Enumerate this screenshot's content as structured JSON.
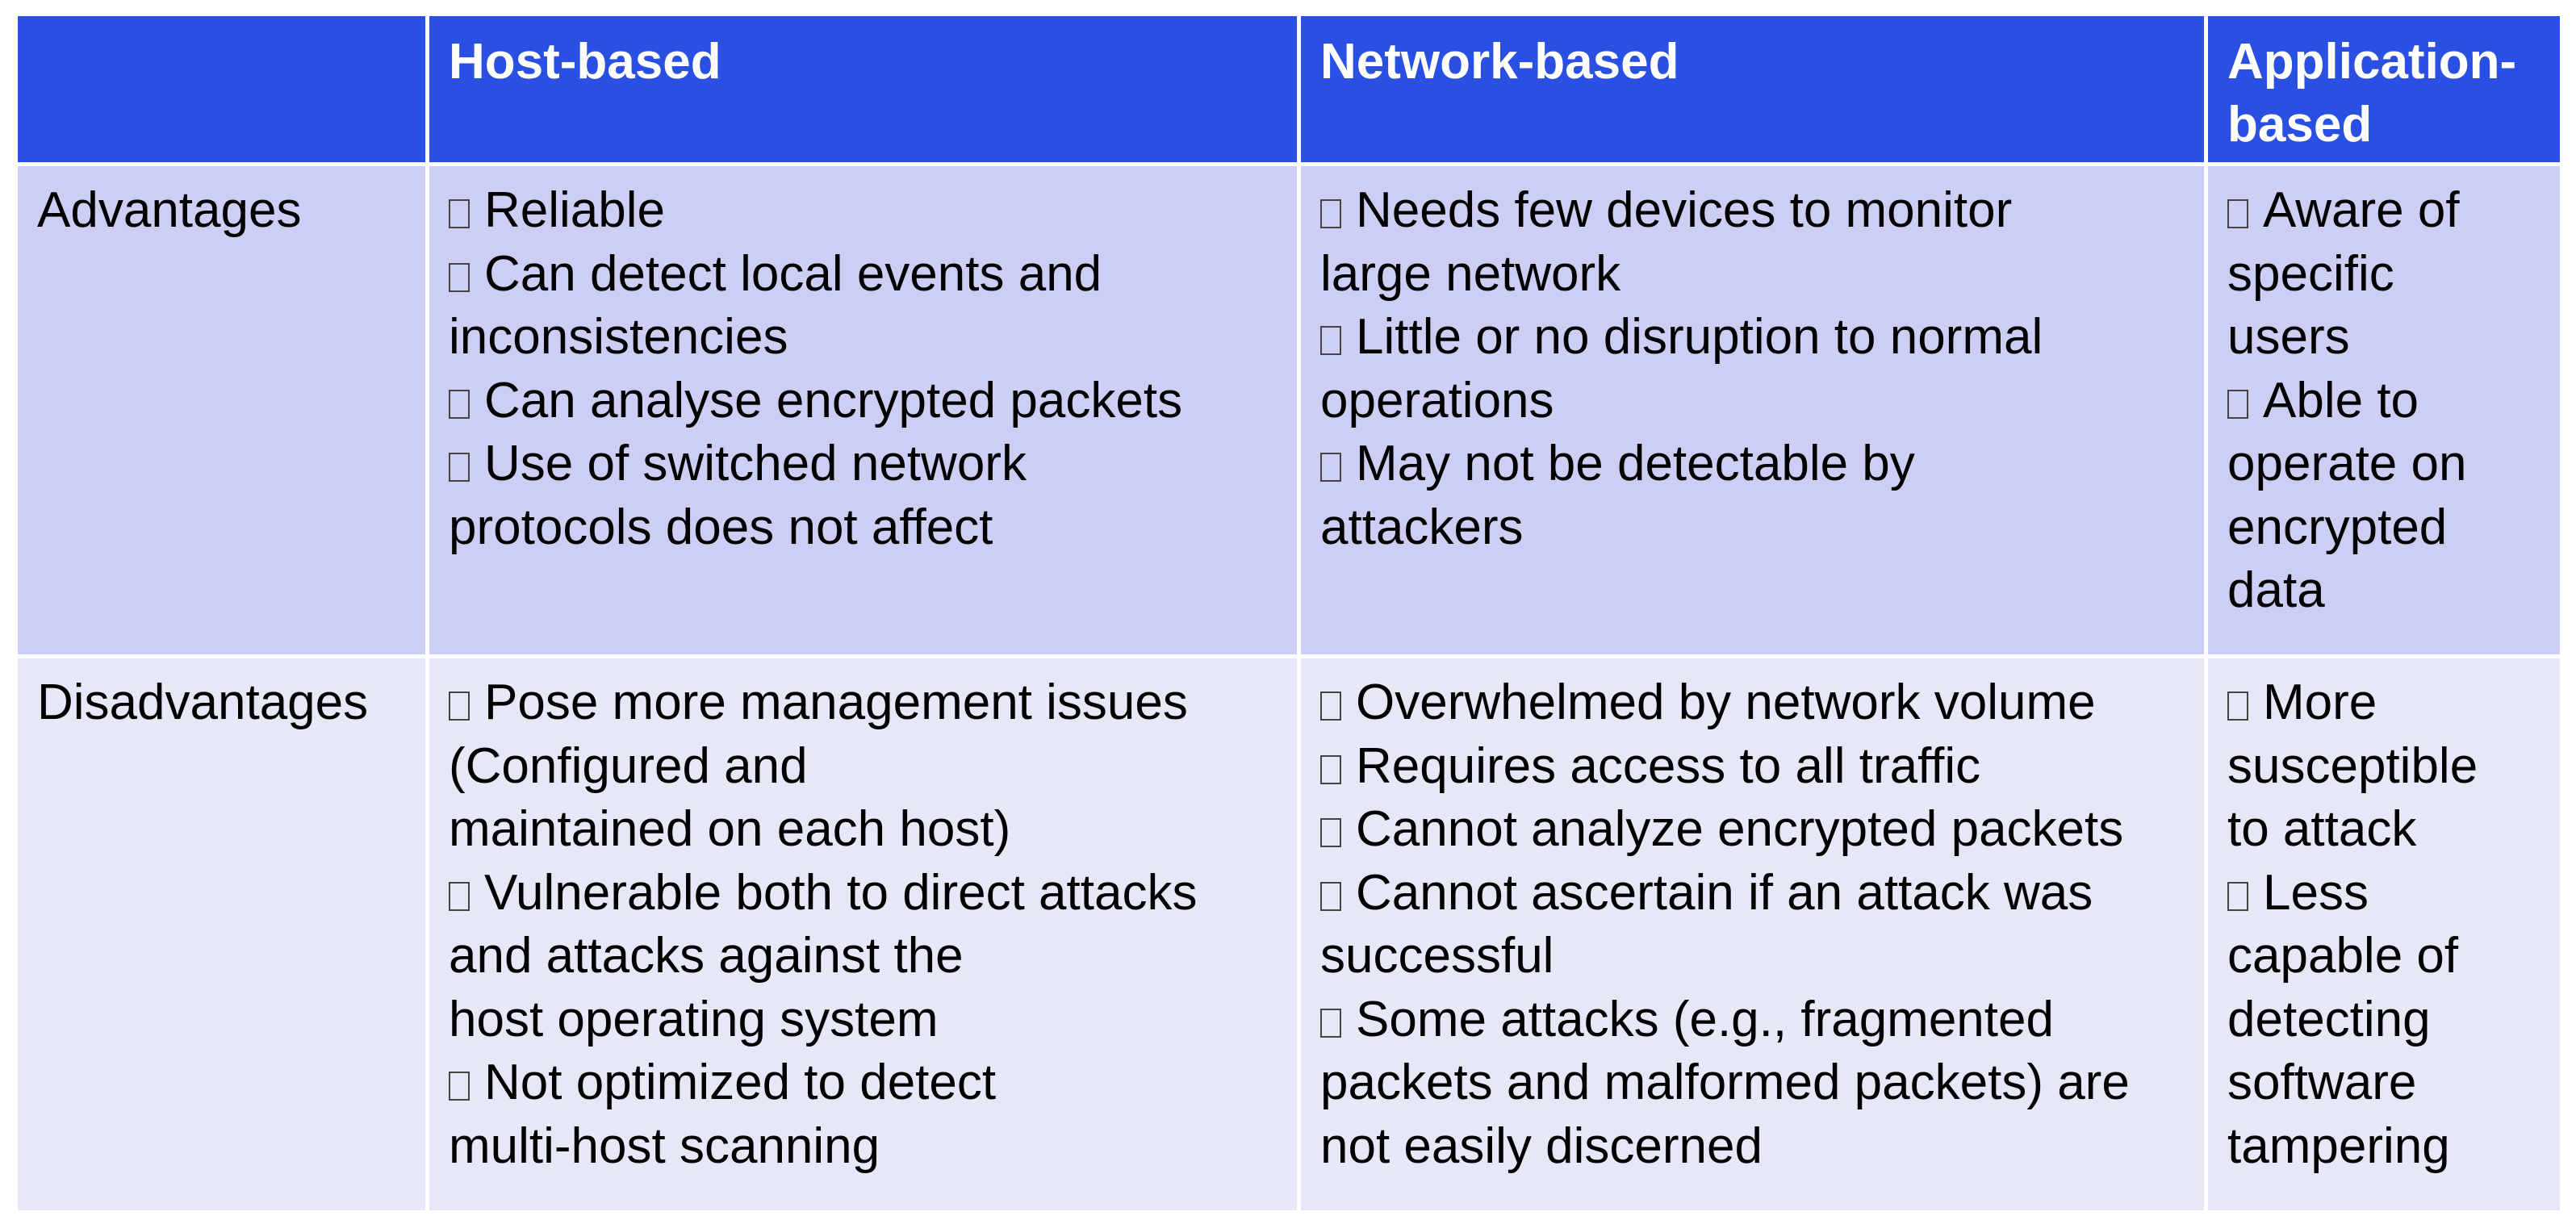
{
  "table": {
    "headers": [
      "",
      "Host-based",
      "Network-based",
      "Application-based"
    ],
    "rows": [
      {
        "label": "Advantages",
        "cells": [
          [
            [
              "Reliable"
            ],
            [
              "Can detect local events and",
              "inconsistencies"
            ],
            [
              "Can analyse encrypted packets"
            ],
            [
              "Use of switched network",
              "protocols does not affect"
            ]
          ],
          [
            [
              "Needs few devices to monitor",
              "large network"
            ],
            [
              "Little or no disruption to normal",
              "operations"
            ],
            [
              "May not be detectable by",
              "attackers"
            ]
          ],
          [
            [
              "Aware of",
              "specific",
              "users"
            ],
            [
              "Able to",
              "operate on",
              "encrypted",
              "data"
            ]
          ]
        ]
      },
      {
        "label": "Disadvantages",
        "cells": [
          [
            [
              "Pose more management issues",
              "(Configured and",
              "maintained on each host)"
            ],
            [
              "Vulnerable both to direct attacks",
              "and attacks against the",
              "host operating system"
            ],
            [
              "Not optimized to detect",
              "multi-host scanning"
            ]
          ],
          [
            [
              "Overwhelmed by network volume"
            ],
            [
              "Requires access to all traffic"
            ],
            [
              "Cannot analyze encrypted packets"
            ],
            [
              "Cannot ascertain if an attack was",
              "successful"
            ],
            [
              "Some attacks (e.g., fragmented",
              "packets and malformed packets) are",
              "not easily discerned"
            ]
          ],
          [
            [
              "More",
              "susceptible",
              "to attack"
            ],
            [
              "Less",
              "capable of",
              "detecting",
              "software",
              "tampering"
            ]
          ]
        ]
      }
    ]
  },
  "colors": {
    "header_bg": "#2a4fe3",
    "advantages_row_bg": "#cdcef3",
    "disadvantages_row_bg": "#e6e7f7",
    "header_text": "#ffffff"
  },
  "icons": {
    "bullet": "missing-glyph-box-icon"
  }
}
